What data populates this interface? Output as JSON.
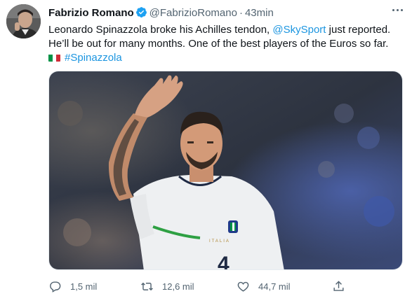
{
  "tweet": {
    "author_name": "Fabrizio Romano",
    "handle": "@FabrizioRomano",
    "separator": "·",
    "time": "43min",
    "text_line1_prefix": "Leonardo Spinazzola broke his Achilles tendon, ",
    "mention": "@SkySport",
    "text_line1_suffix": " just reported.",
    "text_line2": "He’ll be out for many months. One of the best players of the Euros so far.",
    "hashtag": "#Spinazzola",
    "flag_icon": "italy-flag-emoji"
  },
  "media": {
    "jersey_text": "ITALIA",
    "number": "4"
  },
  "actions": {
    "replies": "1,5 mil",
    "retweets": "12,6 mil",
    "likes": "44,7 mil"
  },
  "colors": {
    "link": "#1b95e0",
    "verified": "#1da1f2",
    "muted": "#536471",
    "text": "#0f1419"
  }
}
